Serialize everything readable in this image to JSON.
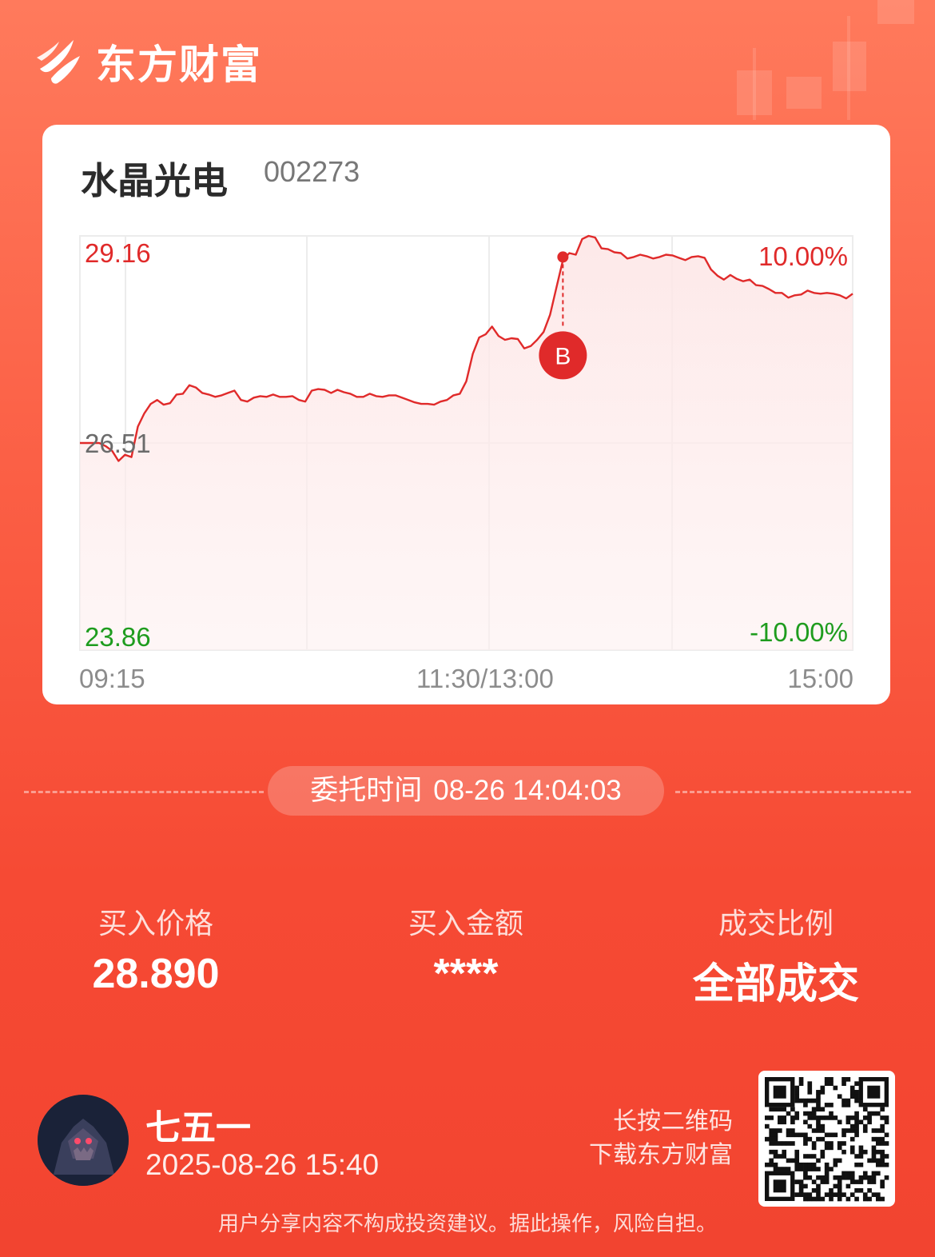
{
  "brand": {
    "name": "东方财富"
  },
  "stock": {
    "name": "水晶光电",
    "code": "002273"
  },
  "chart_data": {
    "type": "line",
    "title": "",
    "y_labels": {
      "high": "29.16",
      "mid": "26.51",
      "low": "23.86"
    },
    "pct_labels": {
      "high": "10.00%",
      "low": "-10.00%"
    },
    "x_labels": {
      "start": "09:15",
      "mid": "11:30/13:00",
      "end": "15:00"
    },
    "ylim": [
      23.86,
      29.16
    ],
    "prev_close": 26.51,
    "marker": {
      "label": "B",
      "x_index": 75,
      "price": 28.89
    },
    "series": [
      {
        "values": [
          26.51,
          26.51,
          26.51,
          26.51,
          26.47,
          26.41,
          26.28,
          26.36,
          26.33,
          26.72,
          26.89,
          27.01,
          27.06,
          27.0,
          27.02,
          27.13,
          27.14,
          27.25,
          27.22,
          27.15,
          27.13,
          27.1,
          27.12,
          27.15,
          27.18,
          27.06,
          27.04,
          27.09,
          27.11,
          27.1,
          27.13,
          27.1,
          27.1,
          27.11,
          27.06,
          27.04,
          27.18,
          27.2,
          27.19,
          27.15,
          27.19,
          27.16,
          27.14,
          27.1,
          27.1,
          27.14,
          27.11,
          27.1,
          27.12,
          27.12,
          27.09,
          27.06,
          27.03,
          27.01,
          27.01,
          27.0,
          27.04,
          27.06,
          27.12,
          27.14,
          27.3,
          27.65,
          27.86,
          27.9,
          28.0,
          27.88,
          27.83,
          27.85,
          27.84,
          27.72,
          27.75,
          27.83,
          27.93,
          28.15,
          28.5,
          28.85,
          28.94,
          28.92,
          29.12,
          29.16,
          29.14,
          29.0,
          28.99,
          28.95,
          28.94,
          28.87,
          28.89,
          28.92,
          28.9,
          28.87,
          28.89,
          28.92,
          28.91,
          28.88,
          28.85,
          28.89,
          28.9,
          28.88,
          28.73,
          28.65,
          28.6,
          28.66,
          28.61,
          28.58,
          28.6,
          28.53,
          28.52,
          28.48,
          28.43,
          28.43,
          28.37,
          28.4,
          28.41,
          28.46,
          28.43,
          28.42,
          28.43,
          28.42,
          28.4,
          28.36,
          28.42
        ]
      }
    ]
  },
  "order": {
    "label": "委托时间",
    "time": "08-26 14:04:03"
  },
  "stats": {
    "price_label": "买入价格",
    "price_value": "28.890",
    "amount_label": "买入金额",
    "amount_value": "****",
    "ratio_label": "成交比例",
    "ratio_value": "全部成交"
  },
  "user": {
    "name": "七五一",
    "datetime": "2025-08-26 15:40"
  },
  "qr": {
    "line1": "长按二维码",
    "line2": "下载东方财富"
  },
  "disclaimer": "用户分享内容不构成投资建议。据此操作，风险自担。",
  "colors": {
    "up": "#e02a2a",
    "down": "#1e9c1e",
    "accent": "#f64a34"
  }
}
